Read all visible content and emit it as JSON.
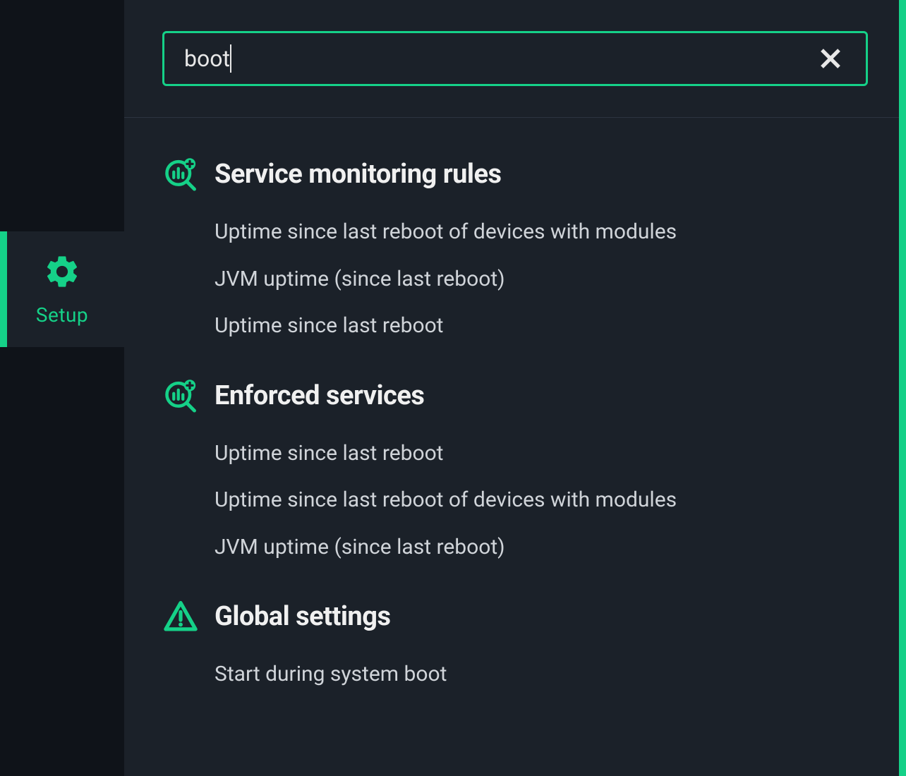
{
  "sidebar": {
    "setup_label": "Setup"
  },
  "search": {
    "value": "boot"
  },
  "sections": [
    {
      "icon": "magnify-chart-plus-icon",
      "title": "Service monitoring rules",
      "items": [
        "Uptime since last reboot of devices with modules",
        "JVM uptime (since last reboot)",
        "Uptime since last reboot"
      ]
    },
    {
      "icon": "magnify-chart-plus-icon",
      "title": "Enforced services",
      "items": [
        "Uptime since last reboot",
        "Uptime since last reboot of devices with modules",
        "JVM uptime (since last reboot)"
      ]
    },
    {
      "icon": "warning-triangle-icon",
      "title": "Global settings",
      "items": [
        "Start during system boot"
      ]
    }
  ]
}
